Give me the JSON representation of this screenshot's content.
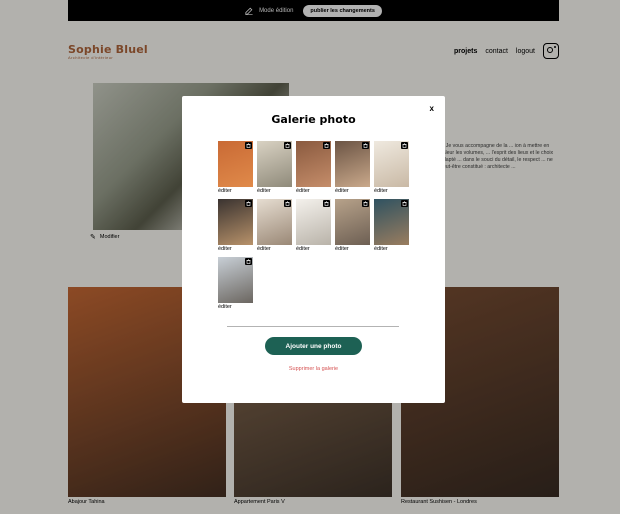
{
  "topbar": {
    "mode_label": "Mode édition",
    "publish_label": "publier les changements"
  },
  "header": {
    "logo": "Sophie Bluel",
    "logo_sub": "Architecte d'intérieur",
    "nav": [
      "projets",
      "contact",
      "logout"
    ]
  },
  "intro": {
    "modify_label": "Modifier",
    "text": "... Je vous accompagne de la ... ion à mettre en valeur les volumes, ... l'esprit des lieux et le choix adapté ... dans le souci du détail, le respect ... ne peut-être constitué : architecte ..."
  },
  "gallery": [
    {
      "caption": "Abajour Tahina",
      "color": "#c96a35"
    },
    {
      "caption": "Appartement Paris V",
      "color": "#9c7a5b"
    },
    {
      "caption": "Restaurant Sushisen - Londres",
      "color": "#7a4e33"
    }
  ],
  "modal": {
    "title": "Galerie photo",
    "close_label": "x",
    "edit_label": "éditer",
    "thumbnails": [
      {
        "colors": [
          "#c96a35",
          "#e08a4a"
        ]
      },
      {
        "colors": [
          "#d9d2c3",
          "#8f8a7a"
        ]
      },
      {
        "colors": [
          "#8a5a3f",
          "#c58d6a"
        ]
      },
      {
        "colors": [
          "#6b5444",
          "#caa98b"
        ]
      },
      {
        "colors": [
          "#efe9df",
          "#c9b9a5"
        ]
      },
      {
        "colors": [
          "#3a3330",
          "#b8926a"
        ]
      },
      {
        "colors": [
          "#e6ddd1",
          "#9a8876"
        ]
      },
      {
        "colors": [
          "#f4f1ec",
          "#b9b3a9"
        ]
      },
      {
        "colors": [
          "#b7a28a",
          "#6d5f53"
        ]
      },
      {
        "colors": [
          "#2f5261",
          "#9a7d5f"
        ]
      },
      {
        "colors": [
          "#c8cfd6",
          "#6b6660"
        ]
      }
    ],
    "add_button_label": "Ajouter une photo",
    "delete_link_label": "Supprimer la galerie"
  },
  "colors": {
    "accent": "#1d6154",
    "brand": "#b1663c",
    "danger": "#d65353"
  }
}
